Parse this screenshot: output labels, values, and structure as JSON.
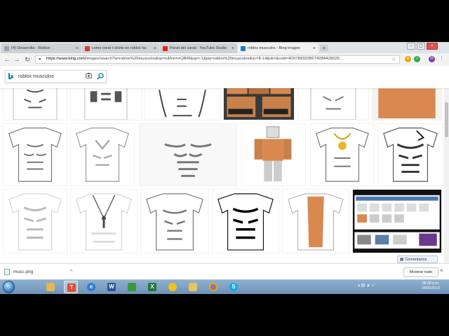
{
  "browser": {
    "tabs": [
      {
        "title": "(4) Desarrolla - Roblox",
        "favicon_color": "#9aa3ad",
        "active": false
      },
      {
        "title": "como crear t-shirts en roblox ha",
        "favicon_color": "#d33a2f",
        "active": false
      },
      {
        "title": "Panel del canal - YouTube Studio",
        "favicon_color": "#e62117",
        "active": false
      },
      {
        "title": "roblox musculos - Bing images",
        "favicon_color": "#1b7cc4",
        "active": true
      }
    ],
    "tab_close_glyph": "×",
    "new_tab_glyph": "+",
    "window_controls": [
      "–",
      "▢",
      "×"
    ],
    "nav": {
      "back": "←",
      "forward": "→",
      "reload": "↻"
    },
    "address": {
      "lock_icon": "lock-icon",
      "host": "https://www.bing.com",
      "rest": "/images/search?q=roblox%20musculos&qs=n&form=QBIR&sp=-1&pq=roblox%20musculos&sc=8-14&sk=&cvid=4D0789332B074284A28026..."
    },
    "bookmark_star": "☆"
  },
  "bing": {
    "search_value": "roblox musculos",
    "camera_icon": "camera-icon",
    "search_icon": "magnifier-icon"
  },
  "results": {
    "feedback_label": "Comentarios"
  },
  "downloads": {
    "file_name": "musc.png",
    "show_all_label": "Mostrar todo",
    "close_glyph": "×"
  },
  "taskbar": {
    "apps": [
      {
        "icon": "folder-icon",
        "letter": "",
        "color": "#e6b84a"
      },
      {
        "icon": "t-app-icon",
        "letter": "T",
        "color": "#e64a2a",
        "active": true
      },
      {
        "icon": "ie-icon",
        "letter": "e",
        "color": "#2b7bd6"
      },
      {
        "icon": "word-icon",
        "letter": "W",
        "color": "#2a5699"
      },
      {
        "icon": "picture-icon",
        "letter": "",
        "color": "#3a9a3a"
      },
      {
        "icon": "excel-icon",
        "letter": "X",
        "color": "#1f7a3e"
      },
      {
        "icon": "clock-app-icon",
        "letter": "",
        "color": "#f3c31c"
      },
      {
        "icon": "folder2-icon",
        "letter": "",
        "color": "#e6c65a"
      },
      {
        "icon": "chrome-icon",
        "letter": "",
        "color": "#d84b3c"
      },
      {
        "icon": "skype-icon",
        "letter": "S",
        "color": "#1aa3e6"
      }
    ],
    "time": "08:36 p.m.",
    "date": "24/05/2019"
  },
  "colors": {
    "bing_blue": "#00809d",
    "orange_shirt": "#d9894f"
  }
}
